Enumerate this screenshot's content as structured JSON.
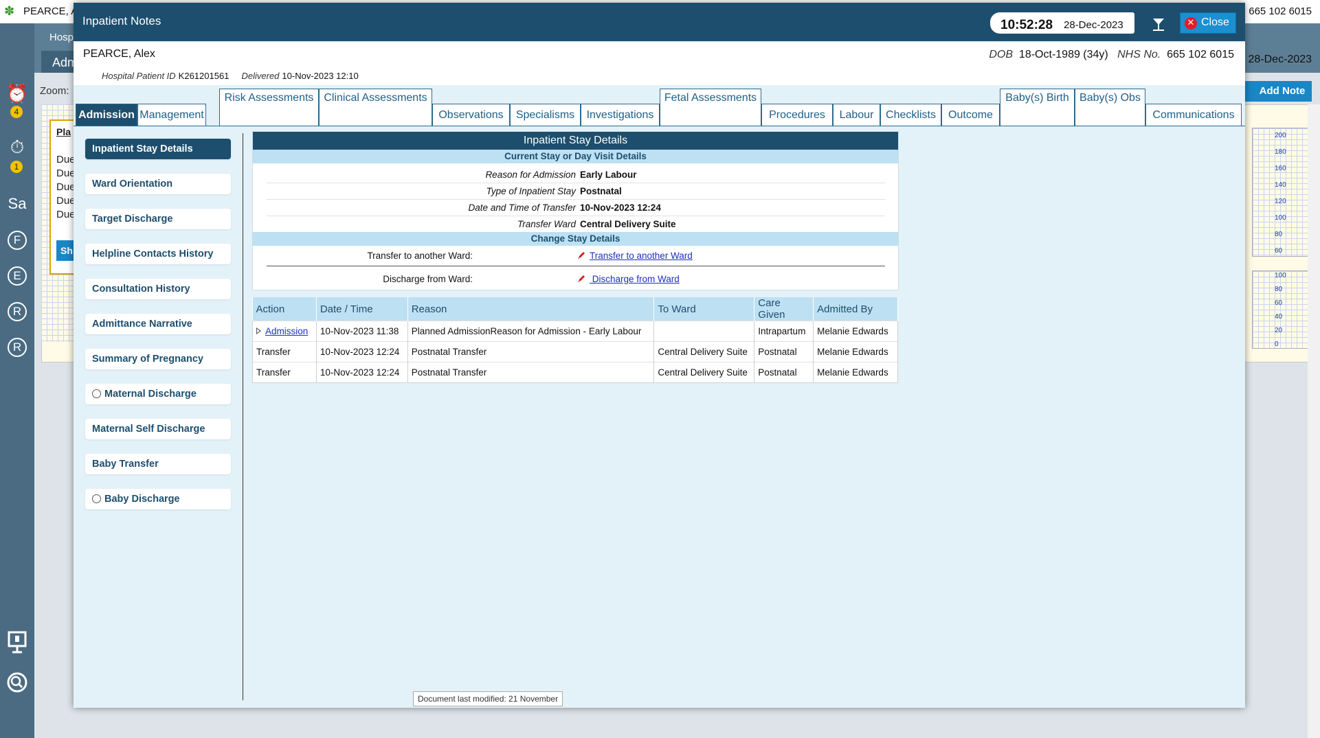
{
  "background": {
    "patient_name": "PEARCE, A",
    "nhs_number": "665 102 6015",
    "hosp_label": "Hosp",
    "adm_label": "Adm",
    "date": "28-Dec-2023",
    "zoom_label": "Zoom:",
    "add_note_label": "Add Note",
    "sidebar": {
      "badge_alarm": "4",
      "badge_timer": "1",
      "letters": [
        "Sa",
        "F",
        "E",
        "R",
        "R"
      ]
    },
    "plan_card": {
      "title": "Pla",
      "due_items": [
        "Due",
        "Due",
        "Due",
        "Due",
        "Due"
      ],
      "button_label": "Sh"
    },
    "scale_top": [
      "200",
      "180",
      "160",
      "140",
      "120",
      "100",
      "80",
      "60"
    ],
    "scale_bottom": [
      "100",
      "80",
      "60",
      "40",
      "20",
      "0"
    ]
  },
  "modal": {
    "title": "Inpatient Notes",
    "clock_time": "10:52:28",
    "clock_date": "28-Dec-2023",
    "close_label": "Close",
    "patient": {
      "name": "PEARCE, Alex",
      "dob_label": "DOB",
      "dob_value": "18-Oct-1989 (34y)",
      "nhs_label": "NHS No.",
      "nhs_value": "665 102 6015",
      "hospital_id_label": "Hospital Patient ID",
      "hospital_id_value": "K261201561",
      "delivered_label": "Delivered",
      "delivered_value": "10-Nov-2023 12:10"
    },
    "tabs": [
      {
        "label": "Admission",
        "active": true
      },
      {
        "label": "Management"
      },
      {
        "label": "Risk Assessments"
      },
      {
        "label": "Clinical Assessments"
      },
      {
        "label": "Observations"
      },
      {
        "label": "Specialisms"
      },
      {
        "label": "Investigations"
      },
      {
        "label": "Fetal Assessments"
      },
      {
        "label": "Procedures"
      },
      {
        "label": "Labour"
      },
      {
        "label": "Checklists"
      },
      {
        "label": "Outcome"
      },
      {
        "label": "Baby(s) Birth"
      },
      {
        "label": "Baby(s) Obs"
      },
      {
        "label": "Communications"
      }
    ],
    "nav": [
      {
        "label": "Inpatient Stay Details",
        "active": true
      },
      {
        "label": "Ward Orientation"
      },
      {
        "label": "Target Discharge"
      },
      {
        "label": "Helpline Contacts History"
      },
      {
        "label": "Consultation History"
      },
      {
        "label": "Admittance Narrative"
      },
      {
        "label": "Summary of Pregnancy"
      },
      {
        "label": "Maternal Discharge",
        "radio": true
      },
      {
        "label": "Maternal Self Discharge"
      },
      {
        "label": "Baby Transfer"
      },
      {
        "label": "Baby Discharge",
        "radio": true
      }
    ],
    "stay_details": {
      "title": "Inpatient Stay Details",
      "current_heading": "Current Stay or Day Visit Details",
      "fields": [
        {
          "label": "Reason for Admission",
          "value": "Early Labour"
        },
        {
          "label": "Type of Inpatient Stay",
          "value": "Postnatal"
        },
        {
          "label": "Date and Time of Transfer",
          "value": "10-Nov-2023 12:24"
        },
        {
          "label": "Transfer Ward",
          "value": "Central Delivery Suite"
        }
      ],
      "change_heading": "Change Stay Details",
      "transfer_label": "Transfer to another Ward:",
      "transfer_link": "Transfer to another Ward",
      "discharge_label": "Discharge from Ward:",
      "discharge_link": " Discharge from Ward"
    },
    "actions_table": {
      "columns": [
        "Action",
        "Date / Time",
        "Reason",
        "To Ward",
        "Care Given",
        "Admitted By"
      ],
      "rows": [
        [
          "Admission",
          "10-Nov-2023 11:38",
          "Planned AdmissionReason for Admission - Early Labour",
          "",
          "Intrapartum",
          "Melanie Edwards"
        ],
        [
          "Transfer",
          "10-Nov-2023 12:24",
          "Postnatal Transfer",
          "Central Delivery Suite",
          "Postnatal",
          "Melanie Edwards"
        ],
        [
          "Transfer",
          "10-Nov-2023 12:24",
          "Postnatal Transfer",
          "Central Delivery Suite",
          "Postnatal",
          "Melanie Edwards"
        ]
      ]
    },
    "doc_modified": "Document last modified: 21 November"
  },
  "colors": {
    "header": "#1d4e6d",
    "subheading_bg": "#bde0f3",
    "close_button": "#1c8fd0",
    "link": "#1b2fbf"
  }
}
